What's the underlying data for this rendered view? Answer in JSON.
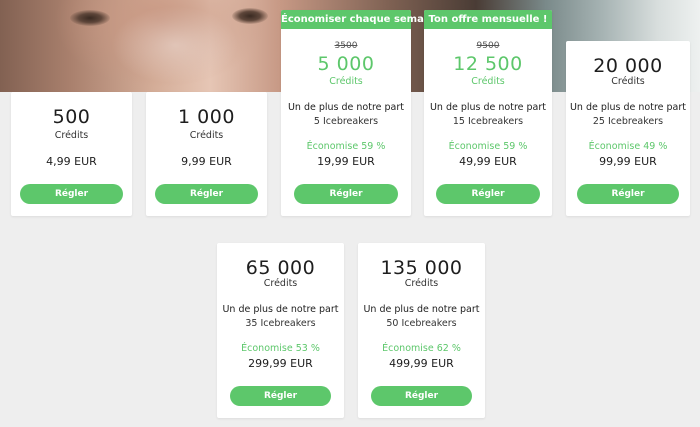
{
  "colors": {
    "accent": "#5dc76b",
    "card": "#ffffff",
    "background": "#eeeeee"
  },
  "packages": [
    {
      "amount": "500",
      "unit": "Crédits",
      "price": "4,99 EUR",
      "button": "Régler"
    },
    {
      "amount": "1 000",
      "unit": "Crédits",
      "price": "9,99 EUR",
      "button": "Régler"
    },
    {
      "promo": "Économiser chaque semaine !",
      "old_amount": "3500",
      "amount": "5 000",
      "unit": "Crédits",
      "extra_title": "Un de plus de notre part",
      "extra_sub": "5 Icebreakers",
      "saving": "Économise 59 %",
      "price": "19,99 EUR",
      "button": "Régler"
    },
    {
      "promo": "Ton offre mensuelle !",
      "old_amount": "9500",
      "amount": "12 500",
      "unit": "Crédits",
      "extra_title": "Un de plus de notre part",
      "extra_sub": "15 Icebreakers",
      "saving": "Économise 59 %",
      "price": "49,99 EUR",
      "button": "Régler"
    },
    {
      "amount": "20 000",
      "unit": "Crédits",
      "extra_title": "Un de plus de notre part",
      "extra_sub": "25 Icebreakers",
      "saving": "Économise 49 %",
      "price": "99,99 EUR",
      "button": "Régler"
    },
    {
      "amount": "65 000",
      "unit": "Crédits",
      "extra_title": "Un de plus de notre part",
      "extra_sub": "35 Icebreakers",
      "saving": "Économise 53 %",
      "price": "299,99 EUR",
      "button": "Régler"
    },
    {
      "amount": "135 000",
      "unit": "Crédits",
      "extra_title": "Un de plus de notre part",
      "extra_sub": "50 Icebreakers",
      "saving": "Économise 62 %",
      "price": "499,99 EUR",
      "button": "Régler"
    }
  ]
}
